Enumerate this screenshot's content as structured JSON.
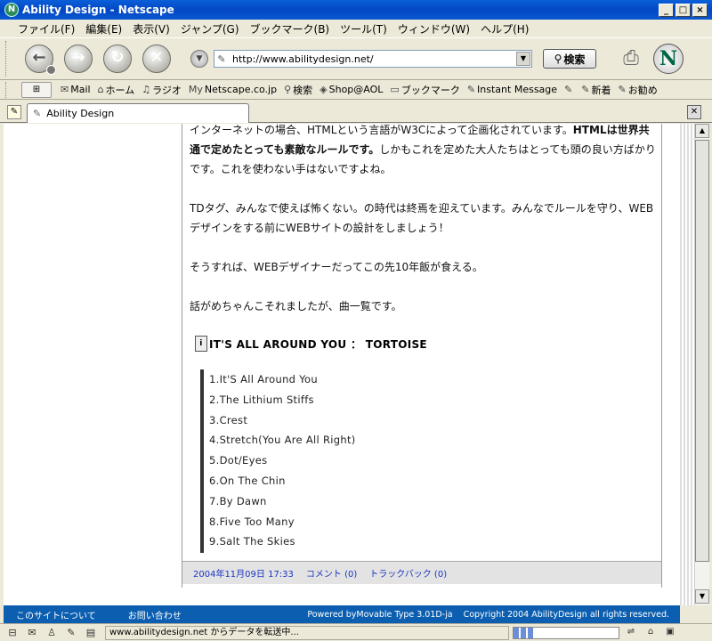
{
  "window": {
    "title": "Ability Design - Netscape",
    "minimize": "_",
    "maximize": "□",
    "close": "×"
  },
  "menu": [
    "ファイル(F)",
    "編集(E)",
    "表示(V)",
    "ジャンプ(G)",
    "ブックマーク(B)",
    "ツール(T)",
    "ウィンドウ(W)",
    "ヘルプ(H)"
  ],
  "nav": {
    "url": "http://www.abilitydesign.net/",
    "search_label": "検索"
  },
  "personal_toolbar": [
    {
      "icon": "mail-icon",
      "glyph": "✉",
      "label": "Mail"
    },
    {
      "icon": "home-icon",
      "glyph": "⌂",
      "label": "ホーム"
    },
    {
      "icon": "radio-icon",
      "glyph": "♫",
      "label": "ラジオ"
    },
    {
      "icon": "my-netscape-icon",
      "glyph": "My",
      "label": "Netscape.co.jp"
    },
    {
      "icon": "search-icon",
      "glyph": "⚲",
      "label": "検索"
    },
    {
      "icon": "shop-icon",
      "glyph": "◈",
      "label": "Shop@AOL"
    },
    {
      "icon": "bookmark-folder-icon",
      "glyph": "▭",
      "label": "ブックマーク"
    },
    {
      "icon": "link-icon",
      "glyph": "✎",
      "label": "Instant Message"
    },
    {
      "icon": "link-icon",
      "glyph": "✎",
      "label": ""
    },
    {
      "icon": "link-icon",
      "glyph": "✎",
      "label": "新着"
    },
    {
      "icon": "link-icon",
      "glyph": "✎",
      "label": "お勧め"
    }
  ],
  "tabs": {
    "active_label": "Ability Design"
  },
  "content": {
    "para1_a": "インターネットの場合、HTMLという言語がW3Cによって企画化されています。",
    "para1_bold": "HTMLは世界共通で定めたとっても素敵なルールです。",
    "para1_b": "しかもこれを定めた大人たちはとっても頭の良い方ばかりです。これを使わない手はないですよね。",
    "para2": "TDタグ、みんなで使えば怖くない。の時代は終焉を迎えています。みんなでルールを守り、WEBデザインをする前にWEBサイトの設計をしましょう！",
    "para3": "そうすれば、WEBデザイナーだってこの先10年飯が食える。",
    "para4": "話がめちゃんこそれましたが、曲一覧です。",
    "album_title": "IT'S ALL AROUND YOU ： TORTOISE",
    "tracks": [
      "1.It'S All Around You",
      "2.The Lithium Stiffs",
      "3.Crest",
      "4.Stretch(You Are All Right)",
      "5.Dot/Eyes",
      "6.On The Chin",
      "7.By Dawn",
      "8.Five Too Many",
      "9.Salt The Skies"
    ],
    "post_date": "2004年11月09日 17:33",
    "comments": "コメント (0)",
    "trackbacks": "トラックバック (0)"
  },
  "site_footer": {
    "about": "このサイトについて",
    "contact": "お問い合わせ",
    "powered": "Powered byMovable Type 3.01D-ja",
    "copyright": "Copyright 2004 AbilityDesign all rights reserved."
  },
  "status": {
    "text": "www.abilitydesign.net からデータを転送中...",
    "progress": 0.2
  }
}
